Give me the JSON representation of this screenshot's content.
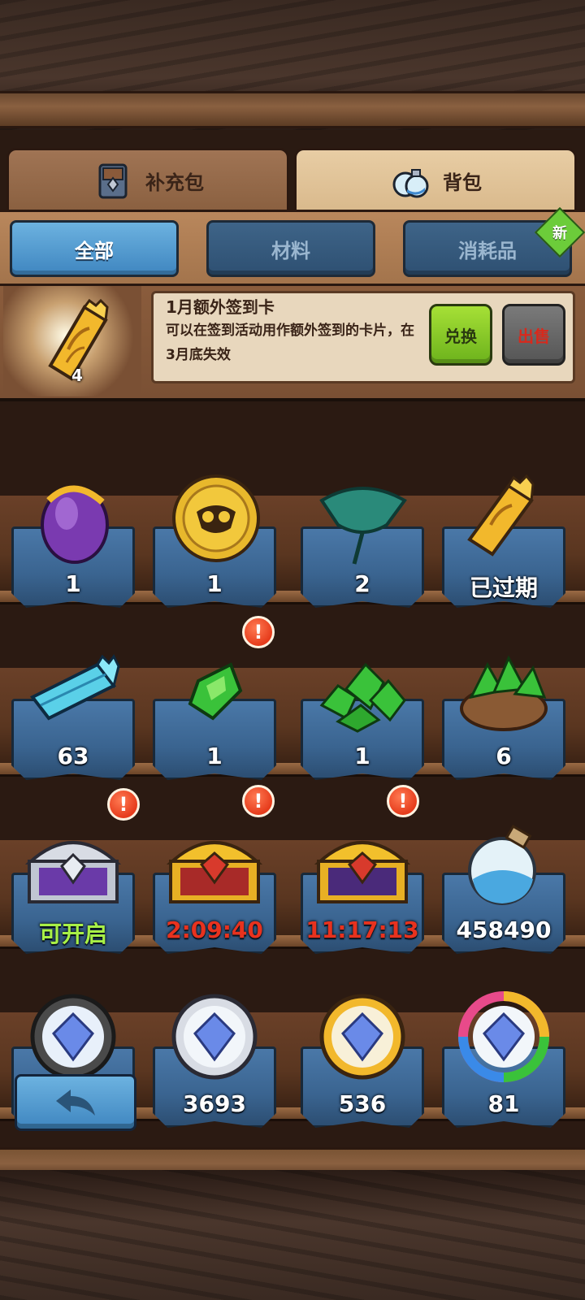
{
  "main_tabs": [
    {
      "label": "补充包",
      "icon": "card-pack-icon",
      "active": false
    },
    {
      "label": "背包",
      "icon": "potion-bag-icon",
      "active": true
    }
  ],
  "sub_tabs": [
    {
      "label": "全部",
      "active": true
    },
    {
      "label": "材料",
      "active": false
    },
    {
      "label": "消耗品",
      "active": false,
      "badge": "新"
    }
  ],
  "detail": {
    "count": "4",
    "title": "1月额外签到卡",
    "description": "可以在签到活动用作额外签到的卡片，在3月底失效",
    "exchange_label": "兑换",
    "sell_label": "出售"
  },
  "items": [
    {
      "icon": "purple-egg-icon",
      "label": "1"
    },
    {
      "icon": "owl-gold-coin-icon",
      "label": "1"
    },
    {
      "icon": "lotus-leaf-icon",
      "label": "2"
    },
    {
      "icon": "golden-ticket-icon",
      "label": "已过期"
    },
    {
      "icon": "blue-ticket-icon",
      "label": "63"
    },
    {
      "icon": "green-crystal-icon",
      "label": "1",
      "alert": "!"
    },
    {
      "icon": "green-crystal-pile-icon",
      "label": "1"
    },
    {
      "icon": "green-crystal-sack-icon",
      "label": "6"
    },
    {
      "icon": "silver-chest-icon",
      "label": "可开启",
      "alert": "!"
    },
    {
      "icon": "gold-chest-icon",
      "label": "2:09:40",
      "alert": "!"
    },
    {
      "icon": "purple-gold-chest-icon",
      "label": "11:17:13",
      "alert": "!"
    },
    {
      "icon": "blue-sand-bottle-icon",
      "label": "458490"
    },
    {
      "icon": "dark-gem-medal-icon",
      "label": ""
    },
    {
      "icon": "silver-gem-medal-icon",
      "label": "3693"
    },
    {
      "icon": "gold-gem-medal-icon",
      "label": "536"
    },
    {
      "icon": "rainbow-gem-medal-icon",
      "label": "81"
    }
  ],
  "back_button_icon": "back-arrow-icon",
  "colors": {
    "active_tab_blue": "#4f96cc",
    "exchange_green": "#8ccc2a",
    "timer_red": "#e8321e",
    "openable_green": "#a8f046"
  }
}
